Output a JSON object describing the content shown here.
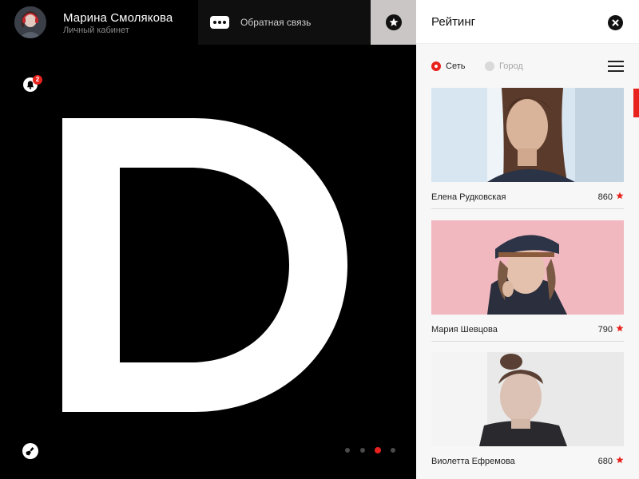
{
  "user": {
    "name": "Марина Смолякова",
    "subtitle": "Личный кабинет"
  },
  "feedback": {
    "label": "Обратная связь",
    "icon": "chat-bubble-icon"
  },
  "notifications": {
    "count": "2",
    "icon": "bell-icon"
  },
  "hero": {
    "letter": "D"
  },
  "pager": {
    "total": 4,
    "active_index": 2
  },
  "rating_panel": {
    "title": "Рейтинг",
    "filters": [
      {
        "label": "Сеть",
        "selected": true
      },
      {
        "label": "Город",
        "selected": false
      }
    ],
    "people": [
      {
        "name": "Елена Рудковская",
        "score": "860"
      },
      {
        "name": "Мария Шевцова",
        "score": "790"
      },
      {
        "name": "Виолетта Ефремова",
        "score": "680"
      }
    ]
  },
  "colors": {
    "accent": "#e8221d",
    "background": "#000000",
    "panel": "#ffffff",
    "rating_tab": "#cbc6c6"
  }
}
